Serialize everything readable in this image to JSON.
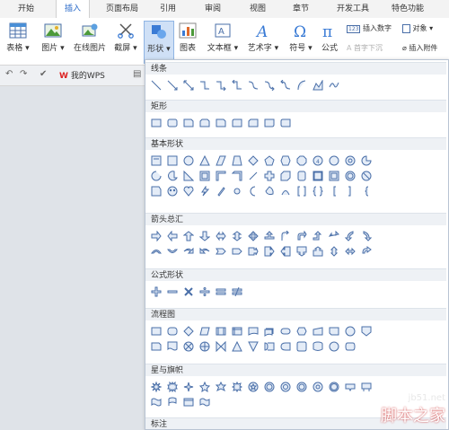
{
  "tabs": [
    "开始",
    "插入",
    "页面布局",
    "引用",
    "审阅",
    "视图",
    "章节",
    "开发工具",
    "特色功能"
  ],
  "active_tab": "插入",
  "ribbon": {
    "table": "表格",
    "picture": "图片",
    "online_picture": "在线图片",
    "screenshot": "截屏",
    "shape": "形状",
    "chart": "图表",
    "textbox": "文本框",
    "wordart": "艺术字",
    "symbol": "符号",
    "formula": "公式",
    "insert_number": "插入数字",
    "object": "对象",
    "dropcap": "首字下沉",
    "attachment": "插入附件"
  },
  "quickbar": {
    "wps_label": "我的WPS"
  },
  "sections": [
    "线条",
    "矩形",
    "基本形状",
    "箭头总汇",
    "公式形状",
    "流程图",
    "星与旗帜",
    "标注"
  ],
  "watermark": {
    "site": "jb51.net",
    "name": "脚本之家"
  },
  "colors": {
    "accent": "#2b6bc9",
    "shape_stroke": "#4a6fa8",
    "shape_fill": "#e4ecf7",
    "selected_bg": "#cfe0f6"
  }
}
